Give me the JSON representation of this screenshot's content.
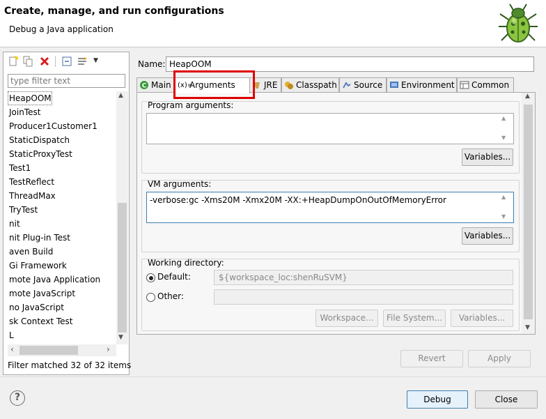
{
  "header": {
    "title": "Create, manage, and run configurations",
    "subtitle": "Debug a Java application"
  },
  "left": {
    "filter_placeholder": "type filter text",
    "items": [
      "HeapOOM",
      "JoinTest",
      "Producer1Customer1",
      "StaticDispatch",
      "StaticProxyTest",
      "Test1",
      "TestReflect",
      "ThreadMax",
      "TryTest",
      "nit",
      "nit Plug-in Test",
      "aven Build",
      "Gi Framework",
      "mote Java Application",
      "mote JavaScript",
      "no JavaScript",
      "sk Context Test",
      "L"
    ],
    "selected_item": "HeapOOM",
    "filter_status": "Filter matched 32 of 32 items"
  },
  "config": {
    "name_label": "Name:",
    "name_value": "HeapOOM",
    "tabs": [
      "Main",
      "Arguments",
      "JRE",
      "Classpath",
      "Source",
      "Environment",
      "Common"
    ],
    "active_tab": "Arguments",
    "program_args_label": "Program arguments:",
    "program_args_value": "",
    "variables_label": "Variables...",
    "vm_args_label": "VM arguments:",
    "vm_args_value": "-verbose:gc -Xms20M -Xmx20M -XX:+HeapDumpOnOutOfMemoryError",
    "working_dir_label": "Working directory:",
    "default_label": "Default:",
    "default_value": "${workspace_loc:shenRuSVM}",
    "other_label": "Other:",
    "other_value": "",
    "workspace_btn": "Workspace...",
    "filesystem_btn": "File System...",
    "variables_btn_disabled": "Variables..."
  },
  "actions": {
    "revert": "Revert",
    "apply": "Apply",
    "debug": "Debug",
    "close": "Close"
  },
  "colors": {
    "highlight": "#e00000",
    "dialog_bg": "#f0f0f0"
  }
}
